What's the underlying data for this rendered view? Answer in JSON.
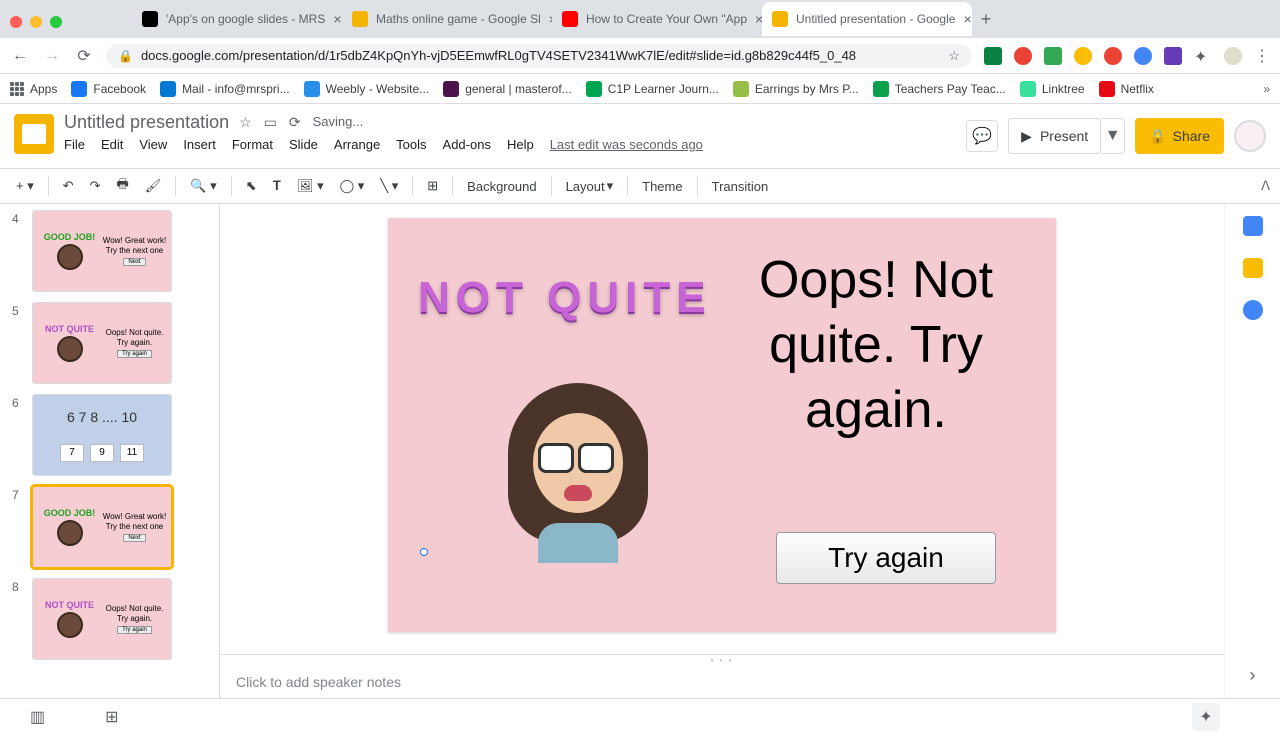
{
  "browser": {
    "tabs": [
      {
        "label": "'App's on google slides - MRS",
        "favicon": "#000"
      },
      {
        "label": "Maths online game - Google Sl",
        "favicon": "#f4b400"
      },
      {
        "label": "How to Create Your Own \"App",
        "favicon": "#ff0000"
      },
      {
        "label": "Untitled presentation - Google",
        "favicon": "#f4b400",
        "active": true
      }
    ],
    "url": "docs.google.com/presentation/d/1r5dbZ4KpQnYh-vjD5EEmwfRL0gTV4SETV2341WwK7lE/edit#slide=id.g8b829c44f5_0_48"
  },
  "bookmarks": [
    {
      "label": "Apps",
      "color": ""
    },
    {
      "label": "Facebook",
      "color": "#1877f2"
    },
    {
      "label": "Mail - info@mrspri...",
      "color": "#0078d4"
    },
    {
      "label": "Weebly - Website...",
      "color": "#2990ea"
    },
    {
      "label": "general | masterof...",
      "color": "#4a154b"
    },
    {
      "label": "C1P Learner Journ...",
      "color": "#00a551"
    },
    {
      "label": "Earrings by Mrs P...",
      "color": "#96bf48"
    },
    {
      "label": "Teachers Pay Teac...",
      "color": "#0ba04a"
    },
    {
      "label": "Linktree",
      "color": "#39e09b"
    },
    {
      "label": "Netflix",
      "color": "#e50914"
    }
  ],
  "doc": {
    "title": "Untitled presentation",
    "saving": "Saving...",
    "lastedit": "Last edit was seconds ago",
    "menu": [
      "File",
      "Edit",
      "View",
      "Insert",
      "Format",
      "Slide",
      "Arrange",
      "Tools",
      "Add-ons",
      "Help"
    ],
    "present": "Present",
    "share": "Share"
  },
  "toolbar": {
    "background": "Background",
    "layout": "Layout",
    "theme": "Theme",
    "transition": "Transition"
  },
  "filmstrip": [
    {
      "num": "4",
      "type": "good",
      "text": "Wow! Great work! Try the next one",
      "btn": "Next"
    },
    {
      "num": "5",
      "type": "notquite",
      "text": "Oops! Not quite. Try again.",
      "btn": "Try again"
    },
    {
      "num": "6",
      "type": "question",
      "q": "6 7 8 .... 10",
      "opts": [
        "7",
        "9",
        "11"
      ]
    },
    {
      "num": "7",
      "type": "good",
      "text": "Wow! Great work! Try the next one",
      "btn": "Next",
      "selected": true
    },
    {
      "num": "8",
      "type": "notquite",
      "text": "Oops! Not quite. Try again.",
      "btn": "Try again"
    }
  ],
  "canvas": {
    "wordart": "NOT QUITE",
    "text": "Oops! Not quite. Try again.",
    "button": "Try again"
  },
  "notes": {
    "placeholder": "Click to add speaker notes"
  }
}
